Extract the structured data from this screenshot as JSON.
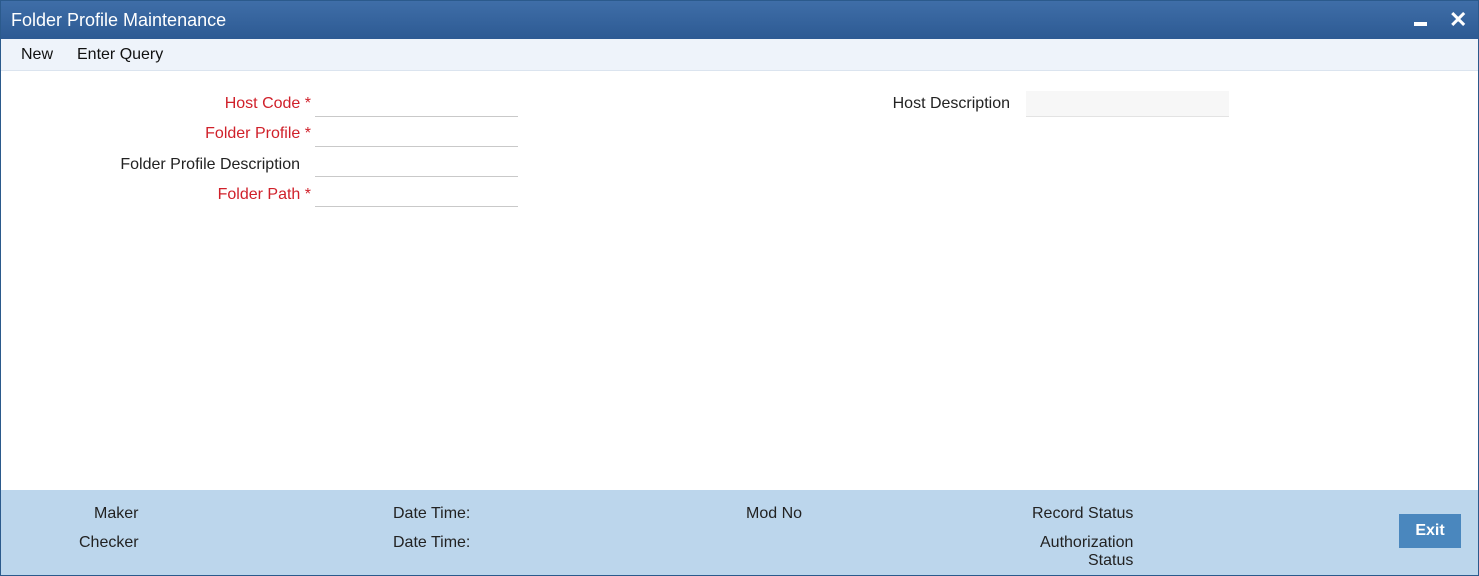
{
  "window": {
    "title": "Folder Profile Maintenance",
    "minimize_icon": "minimize-icon",
    "close_icon": "close-icon"
  },
  "toolbar": {
    "new_label": "New",
    "enter_query_label": "Enter Query"
  },
  "form": {
    "host_code_label": "Host Code",
    "folder_profile_label": "Folder Profile",
    "folder_profile_description_label": "Folder Profile Description",
    "folder_path_label": "Folder Path",
    "host_description_label": "Host Description",
    "required_marker": "*",
    "host_code_value": "",
    "folder_profile_value": "",
    "folder_profile_description_value": "",
    "folder_path_value": "",
    "host_description_value": ""
  },
  "footer": {
    "maker_label": "Maker",
    "checker_label": "Checker",
    "date_time_label_1": "Date Time:",
    "date_time_label_2": "Date Time:",
    "mod_no_label": "Mod No",
    "record_status_label": "Record Status",
    "authorization_label": "Authorization",
    "status_label": "Status",
    "exit_label": "Exit"
  },
  "colors": {
    "titlebar": "#2d5a93",
    "required_text": "#d0202a",
    "footer_bg": "#bcd6ec",
    "exit_button": "#4a87be"
  }
}
